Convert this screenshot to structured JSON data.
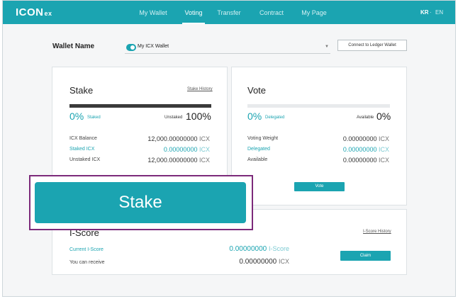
{
  "nav": {
    "logo": "ICON",
    "logo_sub": "ex",
    "items": [
      {
        "label": "My Wallet",
        "active": false
      },
      {
        "label": "Voting",
        "active": true
      },
      {
        "label": "Transfer",
        "active": false
      },
      {
        "label": "Contract",
        "active": false
      },
      {
        "label": "My Page",
        "active": false
      }
    ],
    "lang": {
      "kr": "KR",
      "sep": "·",
      "en": "EN",
      "selected": "KR"
    }
  },
  "wallet": {
    "label": "Wallet Name",
    "selected": "My ICX Wallet",
    "ledger_button": "Connect to Ledger Wallet"
  },
  "stake": {
    "title": "Stake",
    "history_link": "Stake History",
    "staked_pct": "0%",
    "staked_label": "Staked",
    "unstaked_label": "Unstaked",
    "unstaked_pct": "100%",
    "staked_fraction": 0,
    "rows": [
      {
        "label": "ICX Balance",
        "value": "12,000.00000000",
        "unit": "ICX",
        "teal": false
      },
      {
        "label": "Staked ICX",
        "value": "0.00000000",
        "unit": "ICX",
        "teal": true
      },
      {
        "label": "Unstaked ICX",
        "value": "12,000.00000000",
        "unit": "ICX",
        "teal": false
      }
    ]
  },
  "vote": {
    "title": "Vote",
    "delegated_pct": "0%",
    "delegated_label": "Delegated",
    "available_label": "Available",
    "available_pct": "0%",
    "delegated_fraction": 0,
    "rows": [
      {
        "label": "Voting Weight",
        "value": "0.00000000",
        "unit": "ICX",
        "teal": false
      },
      {
        "label": "Delegated",
        "value": "0.00000000",
        "unit": "ICX",
        "teal": true
      },
      {
        "label": "Available",
        "value": "0.00000000",
        "unit": "ICX",
        "teal": false
      }
    ],
    "button": "Vote"
  },
  "iscore": {
    "title": "I-Score",
    "history_link": "I-Score History",
    "current_label": "Current I-Score",
    "current_value": "0.00000000",
    "current_unit": "I-Score",
    "receive_label": "You can receive",
    "receive_value": "0.00000000",
    "receive_unit": "ICX",
    "button": "Claim"
  },
  "overlay": {
    "stake_button": "Stake"
  },
  "colors": {
    "accent": "#1ba4b1",
    "highlight_border": "#7c2a7a",
    "bar_dark": "#3a3a3a",
    "bar_light": "#e8eaec"
  }
}
